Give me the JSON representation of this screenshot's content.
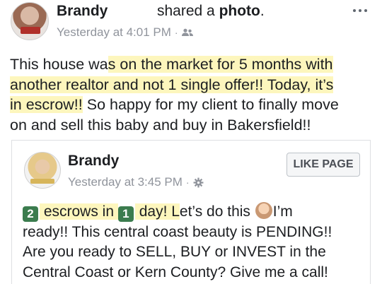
{
  "post": {
    "author": "Brandy",
    "action_text": "shared a ",
    "action_object": "photo",
    "action_suffix": ".",
    "timestamp": "Yesterday at 4:01 PM",
    "separator": "·",
    "audience_icon": "friends-icon",
    "body": {
      "line1_plain": "This house wa",
      "line1_hl": "s on the market for 5 months with",
      "line2_hl": "another realtor and not 1 single offer!!  Today, it’s",
      "line3_hl": "in escrow!!",
      "line3_plain": " So happy for my client to finally move",
      "line4_plain": "on and sell this baby and buy in Bakersfield!!"
    }
  },
  "shared_card": {
    "author": "Brandy",
    "timestamp": "Yesterday at 3:45 PM",
    "separator": "·",
    "visibility_icon": "gear-icon",
    "like_page_label": "LIKE PAGE",
    "text": {
      "badge1": "2",
      "part1_hl": " escrows in ",
      "badge2": "1",
      "part2_hl": " day! L",
      "part2_plain": "et’s do this ",
      "emoji": "woman-tipping-hand-icon",
      "part3_plain": "I’m",
      "line2": "ready!!  This central coast beauty is PENDING!!",
      "line3": "Are you ready to SELL, BUY or INVEST in the",
      "line4": "Central Coast or Kern County? Give me a call!"
    }
  },
  "colors": {
    "highlight": "#fdf6bd",
    "meta_gray": "#90949c",
    "badge_green": "#3b7c4e"
  }
}
